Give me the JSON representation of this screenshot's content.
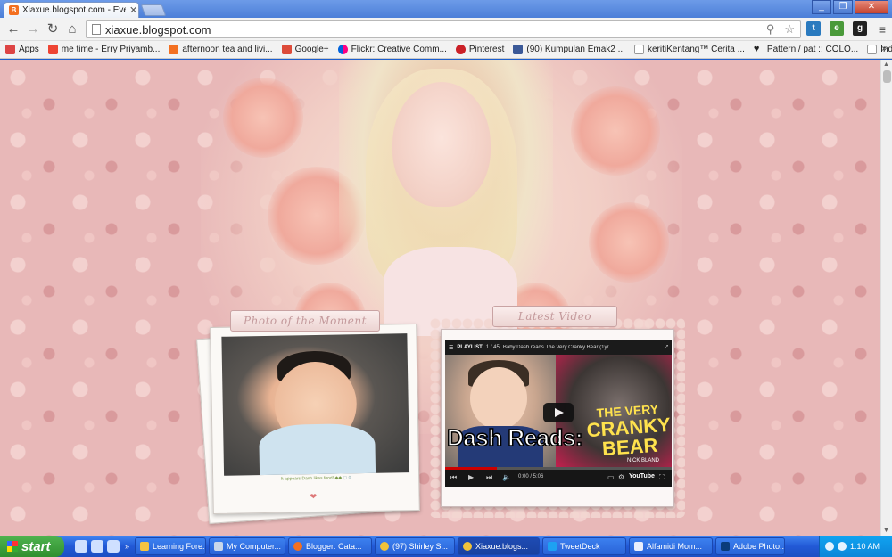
{
  "browser": {
    "tab_title": "Xiaxue.blogspot.com - Every",
    "url": "xiaxue.blogspot.com",
    "window_buttons": {
      "minimize": "_",
      "maximize": "❐",
      "close": "✕"
    }
  },
  "bookmarks": [
    {
      "label": "Apps",
      "icon_color": "#d44"
    },
    {
      "label": "me time - Erry Priyamb...",
      "icon_color": "#e43"
    },
    {
      "label": "afternoon tea and livi...",
      "icon_color": "#f37021"
    },
    {
      "label": "Google+",
      "icon_color": "#dd4b39"
    },
    {
      "label": "Flickr: Creative Comm...",
      "icon_color": "#0063dc"
    },
    {
      "label": "Pinterest",
      "icon_color": "#cb2027"
    },
    {
      "label": "(90) Kumpulan Emak2 ...",
      "icon_color": "#3b5998"
    },
    {
      "label": "keritiKentang™ Cerita ...",
      "icon_color": "#fff"
    },
    {
      "label": "Pattern / pat :: COLO...",
      "icon_color": "#222"
    },
    {
      "label": "Indosat Super Wifi",
      "icon_color": "#fff"
    }
  ],
  "bookmarks_more": "»",
  "blog": {
    "photo_widget_title": "Photo of the Moment",
    "photo_caption": "It appears Dash likes food! ◆◆",
    "photo_comment_count": "0",
    "video_widget_title": "Latest Video",
    "video": {
      "playlist_label": "PLAYLIST",
      "playlist_position": "1 / 45",
      "title": "Baby Dash reads The Very Cranky Bear (1yr ...",
      "overlay_text": "Dash Reads:",
      "book_title_line1": "THE VERY",
      "book_title_line2": "CRANKY",
      "book_title_line3": "BEAR",
      "book_author": "NICK BLAND",
      "time": "0:00 / 5:06",
      "progress_fraction": 0.23,
      "brand": "YouTube"
    }
  },
  "taskbar": {
    "start_label": "start",
    "tasks": [
      {
        "label": "Learning Fore...",
        "icon_color": "#f5c342",
        "active": false
      },
      {
        "label": "My Computer...",
        "icon_color": "#c9d7ea",
        "active": false
      },
      {
        "label": "Blogger: Cata...",
        "icon_color": "#f37021",
        "active": false
      },
      {
        "label": "(97) Shirley S...",
        "icon_color": "#f0c23a",
        "active": false
      },
      {
        "label": "Xiaxue.blogs...",
        "icon_color": "#f0c23a",
        "active": true
      },
      {
        "label": "TweetDeck",
        "icon_color": "#1da1f2",
        "active": false
      },
      {
        "label": "Alfamidi Mom...",
        "icon_color": "#e9eefc",
        "active": false
      },
      {
        "label": "Adobe Photo...",
        "icon_color": "#0a3c7a",
        "active": false
      }
    ],
    "clock": "1:10 AM"
  }
}
